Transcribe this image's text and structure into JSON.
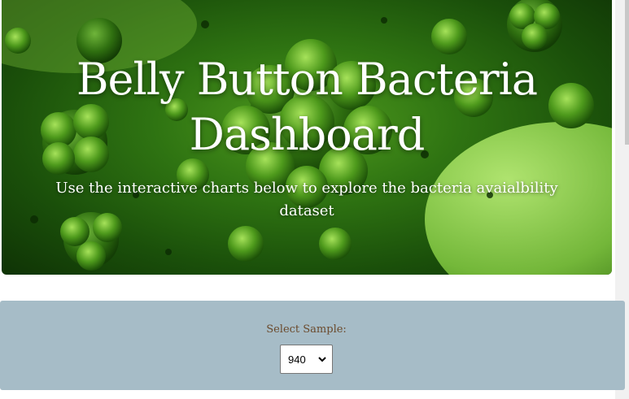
{
  "hero": {
    "title_line1": "Belly Button Bacteria",
    "title_line2": "Dashboard",
    "subtitle_line1": "Use the interactive charts below to explore the bacteria avaialbility",
    "subtitle_line2": "dataset"
  },
  "selector": {
    "label": "Select Sample:",
    "value": "940"
  },
  "colors": {
    "hero_green": "#2f7412",
    "panel_bg": "#a6bcc7",
    "label_text": "#6b4a2c"
  },
  "icons": {
    "select_caret": "chevron-down-icon"
  }
}
